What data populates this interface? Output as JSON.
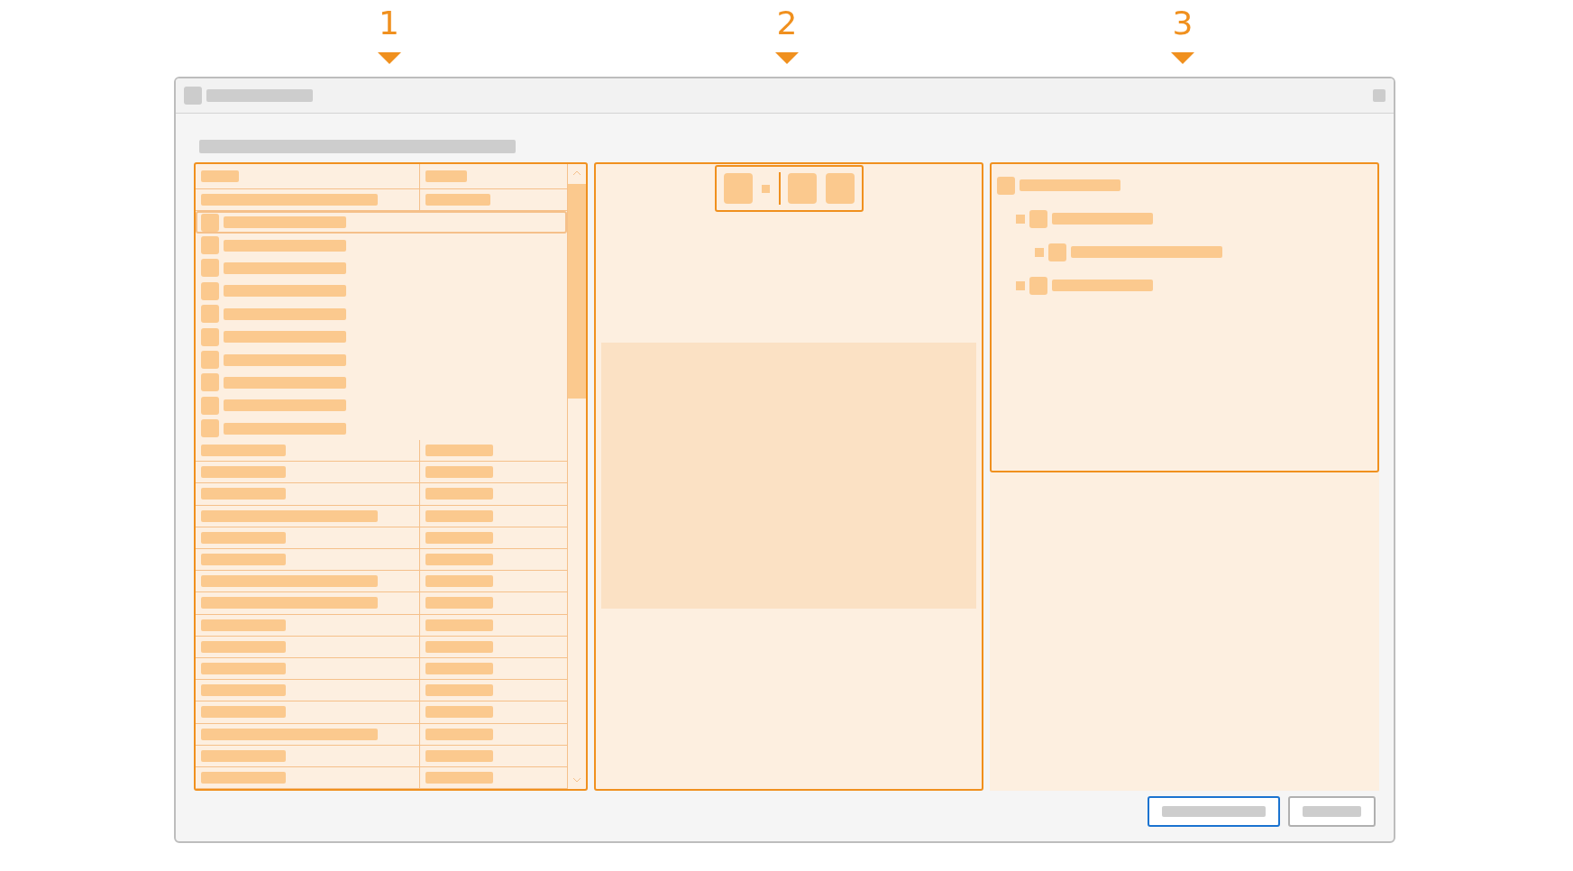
{
  "callouts": [
    {
      "label": "1"
    },
    {
      "label": "2"
    },
    {
      "label": "3"
    }
  ],
  "list": {
    "rows": [
      {
        "kind": "table-row",
        "selected": false
      },
      {
        "kind": "list-item",
        "selected": true
      },
      {
        "kind": "list-item",
        "selected": false
      },
      {
        "kind": "list-item",
        "selected": false
      },
      {
        "kind": "list-item",
        "selected": false
      },
      {
        "kind": "list-item",
        "selected": false
      },
      {
        "kind": "list-item",
        "selected": false
      },
      {
        "kind": "list-item",
        "selected": false
      },
      {
        "kind": "list-item",
        "selected": false
      },
      {
        "kind": "list-item",
        "selected": false
      },
      {
        "kind": "list-item",
        "selected": false
      },
      {
        "kind": "table-row",
        "selected": false
      },
      {
        "kind": "table-row",
        "selected": false
      },
      {
        "kind": "table-row",
        "selected": false
      },
      {
        "kind": "table-row",
        "selected": false
      },
      {
        "kind": "table-row",
        "selected": false
      },
      {
        "kind": "table-row",
        "selected": false
      },
      {
        "kind": "table-row",
        "selected": false
      },
      {
        "kind": "table-row",
        "selected": false
      },
      {
        "kind": "table-row",
        "selected": false
      },
      {
        "kind": "table-row",
        "selected": false
      },
      {
        "kind": "table-row",
        "selected": false
      },
      {
        "kind": "table-row",
        "selected": false
      },
      {
        "kind": "table-row",
        "selected": false
      },
      {
        "kind": "table-row",
        "selected": false
      },
      {
        "kind": "table-row",
        "selected": false
      },
      {
        "kind": "table-row",
        "selected": false
      }
    ]
  },
  "toolbar": [
    {
      "kind": "button"
    },
    {
      "kind": "dot"
    },
    {
      "kind": "separator"
    },
    {
      "kind": "button"
    },
    {
      "kind": "button"
    }
  ],
  "tree": {
    "expandable": false,
    "children": [
      {
        "expandable": true,
        "children": [
          {
            "expandable": true
          }
        ]
      },
      {
        "expandable": true
      }
    ]
  },
  "buttons": [
    {
      "kind": "default"
    },
    {
      "kind": "normal"
    }
  ]
}
